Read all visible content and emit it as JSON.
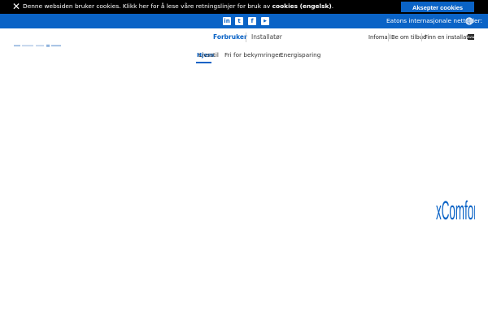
{
  "cookie": {
    "close_glyph": "✕",
    "text_before": "Denne websiden bruker cookies. Klikk her for å lese våre retningslinjer for bruk av ",
    "text_bold": "cookies (engelsk)",
    "text_after": ".",
    "accept_label": "Aksepter cookies"
  },
  "social": {
    "linkedin": "in",
    "twitter": "t",
    "facebook": "f",
    "youtube": "▶",
    "intl_label": "Eatons internasjonale nettsider:"
  },
  "audience": {
    "consumer": "Forbruker",
    "installer": "Installatør"
  },
  "utility": {
    "infomail": "Infomail",
    "quote": "Be om tilbud",
    "find_installer": "Finn en installatør"
  },
  "nav": {
    "items": [
      "Hjem",
      "Livsstil",
      "Fri for bekymringer",
      "Energisparing"
    ]
  },
  "brand": {
    "wordmark": "xComfort"
  },
  "colors": {
    "eaton_blue": "#0a63c6",
    "black": "#000000"
  }
}
